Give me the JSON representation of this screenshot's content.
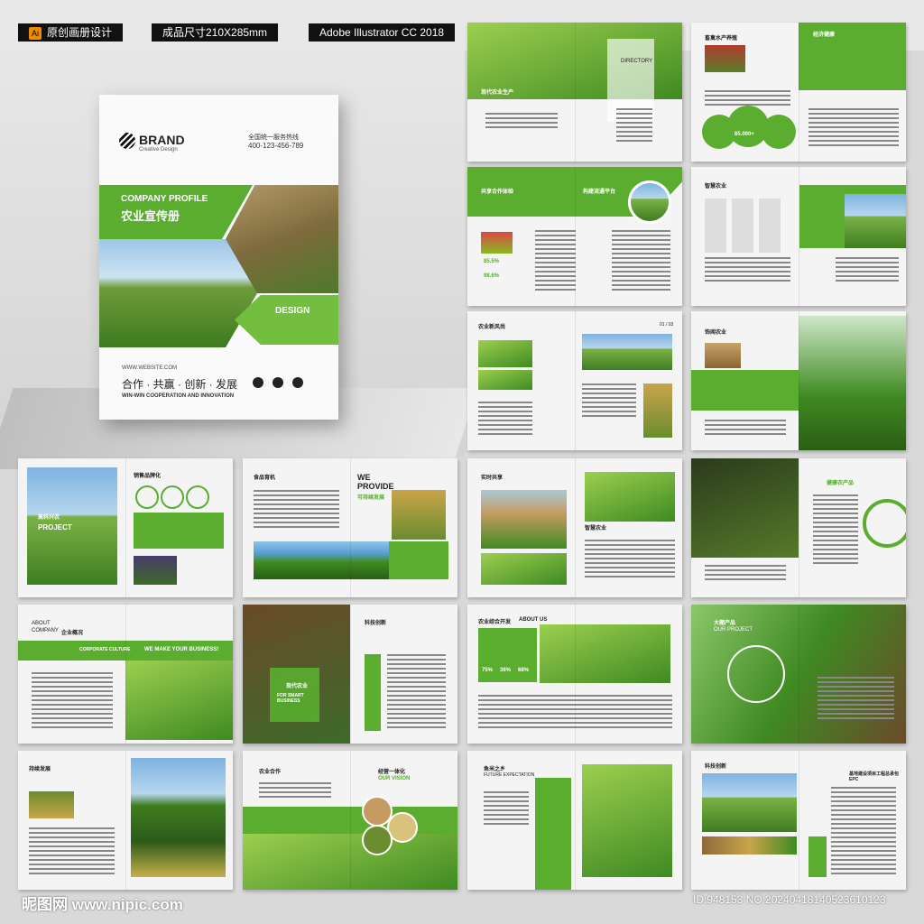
{
  "tags": {
    "design_label": "原创画册设计",
    "size_label": "成品尺寸210X285mm",
    "software_label": "Adobe Illustrator CC 2018",
    "ai_icon": "Ai"
  },
  "cover": {
    "brand": "BRAND",
    "brand_sub": "Creative Design",
    "hotline_label": "全国统一服务热线",
    "hotline": "400-123-456-789",
    "company_profile": "COMPANY PROFILE",
    "title_cn": "农业宣传册",
    "design": "DESIGN",
    "website": "WWW.WEBSITE.COM",
    "slogan": "合作 · 共赢 · 创新 · 发展",
    "slogan_en": "WIN-WIN COOPERATION AND INNOVATION"
  },
  "spreads": {
    "s1_sub": "现代农业生产",
    "s1_directory": "DIRECTORY",
    "s2_title": "畜禽水产养殖",
    "s2_right": "经济健康",
    "s2_stat": "85.000+",
    "s3_left": "共享合作体验",
    "s3_right": "构建流通平台",
    "s3_p1": "85.5%",
    "s3_p2": "98.6%",
    "s4_title": "智慧农业",
    "s5_title": "农业新风尚",
    "s5_page": "01 / 03",
    "s6_title": "饰闻农业",
    "s7_title": "销售品牌化",
    "s7_project_cn": "高科兴农",
    "s7_project": "PROJECT",
    "s8_title": "食品育机",
    "s8_we": "WE",
    "s8_provide": "PROVIDE",
    "s8_sub": "可持续发展",
    "s9_title": "实时共享",
    "s9_sub": "智慧农业",
    "s10_title": "健康农产品",
    "s11_about": "ABOUT",
    "s11_company": "COMPANY",
    "s11_cn": "企业概况",
    "s11_culture": "CORPORATE CULTURE",
    "s11_make": "WE MAKE YOUR BUSINESS!",
    "s12_cn": "现代农业",
    "s12_en": "FOR SMART BUSINESS",
    "s12_title": "科技创新",
    "s13_title": "农业综合开发",
    "s13_about": "ABOUT US",
    "s13_p1": "75%",
    "s13_p2": "36%",
    "s13_p3": "68%",
    "s14_title": "大棚产品",
    "s14_sub": "OUR PROJECT",
    "s15_title": "持续发展",
    "s16_title": "农业合作",
    "s16_right": "经营一体化",
    "s16_vision": "OUR VISION",
    "s17_title": "鱼米之乡",
    "s17_sub": "FUTURE EXPECTATION",
    "s18_title": "科技创新",
    "s18_right": "基地建设项目工程总承包EPC"
  },
  "watermark": {
    "site": "昵图网 www.nipic.com",
    "id": "ID:948153 NO:20240418140523610123"
  }
}
